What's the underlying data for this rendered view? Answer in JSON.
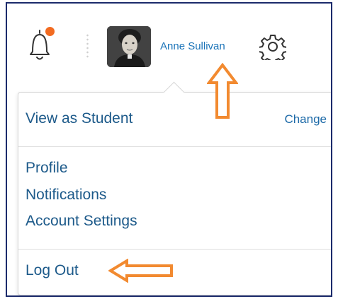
{
  "header": {
    "user_name": "Anne Sullivan",
    "icons": {
      "bell": "bell-icon",
      "notification": "notification-dot",
      "gear": "gear-icon"
    }
  },
  "menu": {
    "view_as_student": "View as Student",
    "change": "Change",
    "profile": "Profile",
    "notifications": "Notifications",
    "account_settings": "Account Settings",
    "log_out": "Log Out"
  },
  "colors": {
    "link": "#1a73b8",
    "notification": "#f26b21",
    "annotation_arrow": "#f28a30",
    "frame": "#1b2a6b"
  }
}
